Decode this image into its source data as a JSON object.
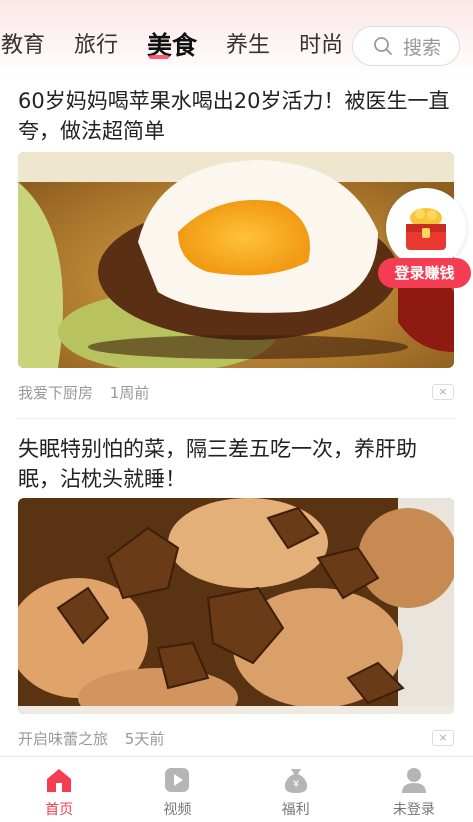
{
  "header": {
    "tabs": [
      {
        "label": "教育",
        "active": false
      },
      {
        "label": "旅行",
        "active": false
      },
      {
        "label": "美食",
        "active": true
      },
      {
        "label": "养生",
        "active": false
      },
      {
        "label": "时尚",
        "active": false
      }
    ],
    "search_placeholder": "搜索"
  },
  "articles": [
    {
      "title": "60岁妈妈喝苹果水喝出20岁活力！被医生一直夸，做法超简单",
      "source": "我爱下厨房",
      "time": "1周前",
      "image": "egg-soup-food-photo"
    },
    {
      "title": "失眠特别怕的菜，隔三差五吃一次，养肝助眠，沾枕头就睡！",
      "source": "开启味蕾之旅",
      "time": "5天前",
      "image": "tea-eggs-food-photo"
    }
  ],
  "floating_promo": {
    "label": "登录赚钱",
    "icon": "treasure-chest-icon"
  },
  "bottom_nav": [
    {
      "label": "首页",
      "icon": "home-icon",
      "active": true
    },
    {
      "label": "视频",
      "icon": "video-icon",
      "active": false
    },
    {
      "label": "福利",
      "icon": "money-bag-icon",
      "active": false
    },
    {
      "label": "未登录",
      "icon": "user-icon",
      "active": false
    }
  ],
  "colors": {
    "accent": "#f43c52",
    "header_bg": "#fbe6e6"
  }
}
